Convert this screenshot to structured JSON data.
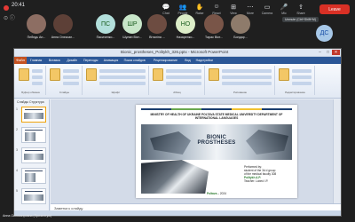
{
  "meeting": {
    "time": "20:41",
    "leave_label": "Leave",
    "tooltip": "Unmute (Ctrl+Shift+M)",
    "controls": [
      {
        "icon": "chat-icon",
        "label": "Chat"
      },
      {
        "icon": "people-icon",
        "label": "People"
      },
      {
        "icon": "raise-icon",
        "label": "Raise"
      },
      {
        "icon": "react-icon",
        "label": "React"
      },
      {
        "icon": "view-icon",
        "label": "View"
      },
      {
        "icon": "more-icon",
        "label": "More"
      },
      {
        "icon": "camera-icon",
        "label": "Camera"
      },
      {
        "icon": "mic-icon",
        "label": "Mic"
      },
      {
        "icon": "share-icon",
        "label": "Share"
      }
    ],
    "participants": [
      {
        "initials": "",
        "name": "Пебедь Ан...",
        "color": "#8d6e63"
      },
      {
        "initials": "",
        "name": "Анна Олексан...",
        "color": "#5d4037"
      },
      {
        "initials": "ПС",
        "name": "Пасиченко...",
        "color": "#b2dfdb"
      },
      {
        "initials": "ШР",
        "name": "Шулан Вікт...",
        "color": "#c8e6c9"
      },
      {
        "initials": "",
        "name": "Віталіна ...",
        "color": "#6d4c41"
      },
      {
        "initials": "НО",
        "name": "Назаренко...",
        "color": "#dcedc8"
      },
      {
        "initials": "",
        "name": "Тарас Вікт...",
        "color": "#795548"
      },
      {
        "initials": "",
        "name": "Бондар...",
        "color": "#8e7b6b"
      }
    ],
    "self_initials": "ДС",
    "presenter_name": "Анна Олексанровна (Презентую)"
  },
  "ppt": {
    "window_title": "Bionic_prostheses_Politykh_326.pptx - Microsoft PowerPoint",
    "file_tab": "Файл",
    "menu": [
      "Главная",
      "Вставка",
      "Дизайн",
      "Переходы",
      "Анимация",
      "Показ слайдов",
      "Рецензирование",
      "Вид",
      "Надстройки"
    ],
    "ribbon_groups": [
      "Буфер обмена",
      "Слайды",
      "Шрифт",
      "Абзац",
      "Рисование",
      "Редактирование"
    ],
    "pane_tabs": [
      "Слайды",
      "Структура"
    ],
    "slide_numbers": [
      "1",
      "2",
      "3",
      "4",
      "5"
    ],
    "notes_placeholder": "Заметки к слайду"
  },
  "slide": {
    "ministry": "MINISTRY OF HEALTH OF UKRAINE POLTAVA STATE MEDICAL UNIVERSITY DEPARTMENT OF INTERNATIONAL LANGUAGES",
    "title": "BIONIC PROSTHESES",
    "performed_lines": [
      "Performed by:",
      "student of the 3d d group",
      "of the medical faculty 308",
      "Politykh A.P.",
      "Teacher: Lobed I.P."
    ],
    "city": "Poltava",
    "year": "– 2024",
    "stripe_colors": [
      "#1a3d6e",
      "#6aa84f",
      "#1a3d6e",
      "#f1c232",
      "#1a3d6e"
    ]
  }
}
